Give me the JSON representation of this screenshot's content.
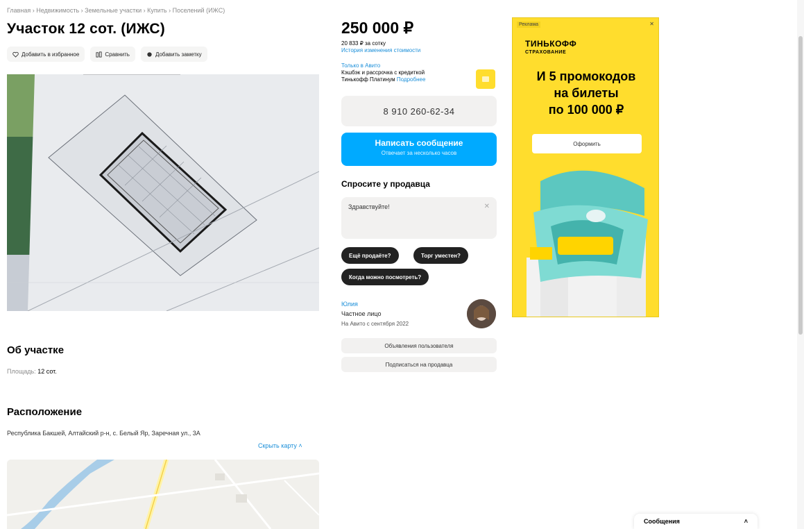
{
  "breadcrumb": "Главная › Недвижимость › Земельные участки › Купить › Поселений (ИЖС)",
  "title": "Участок 12 сот. (ИЖС)",
  "actions": {
    "favorite": "Добавить в избранное",
    "compare": "Сравнить",
    "note": "Добавить заметку"
  },
  "price": {
    "value": "250 000 ₽",
    "per_unit": "20 833 ₽ за сотку",
    "history_link": "История изменения стоимости"
  },
  "promo": {
    "label": "Только в Авито",
    "text": "Кэшбэк и рассрочка с кредиткой",
    "text2": "Тинькофф Платинум",
    "more_link": "Подробнее"
  },
  "contact": {
    "phone": "8 910 260-62-34",
    "message_button": "Написать сообщение",
    "message_sub": "Отвечает за несколько часов"
  },
  "ask": {
    "title": "Спросите у продавца",
    "placeholder": "Здравствуйте!",
    "chips": [
      "Ещё продаёте?",
      "Торг уместен?",
      "Когда можно посмотреть?"
    ]
  },
  "seller": {
    "name": "Юлия",
    "type": "Частное лицо",
    "since": "На Авито с сентября 2022",
    "subscribe": "Подписаться на продавца",
    "all_ads": "Объявления пользователя"
  },
  "ad": {
    "badge": "Реклама",
    "brand": "ТИНЬКОФФ",
    "brand_sub": "СТРАХОВАНИЕ",
    "headline_1": "И 5 промокодов",
    "headline_2": "на билеты",
    "headline_3": "по 100 000 ₽",
    "button": "Оформить"
  },
  "about": {
    "title": "Об участке",
    "area_label": "Площадь:",
    "area_value": "12 сот."
  },
  "location": {
    "title": "Расположение",
    "address": "Республика Бакшей, Алтайский р-н, с. Белый Яр, Заречная ул., 3А",
    "show_map": "Скрыть карту"
  },
  "messages": {
    "label": "Сообщения"
  },
  "colors": {
    "accent": "#00aaff",
    "chip": "#222222",
    "ad_bg": "#ffdd2d"
  }
}
